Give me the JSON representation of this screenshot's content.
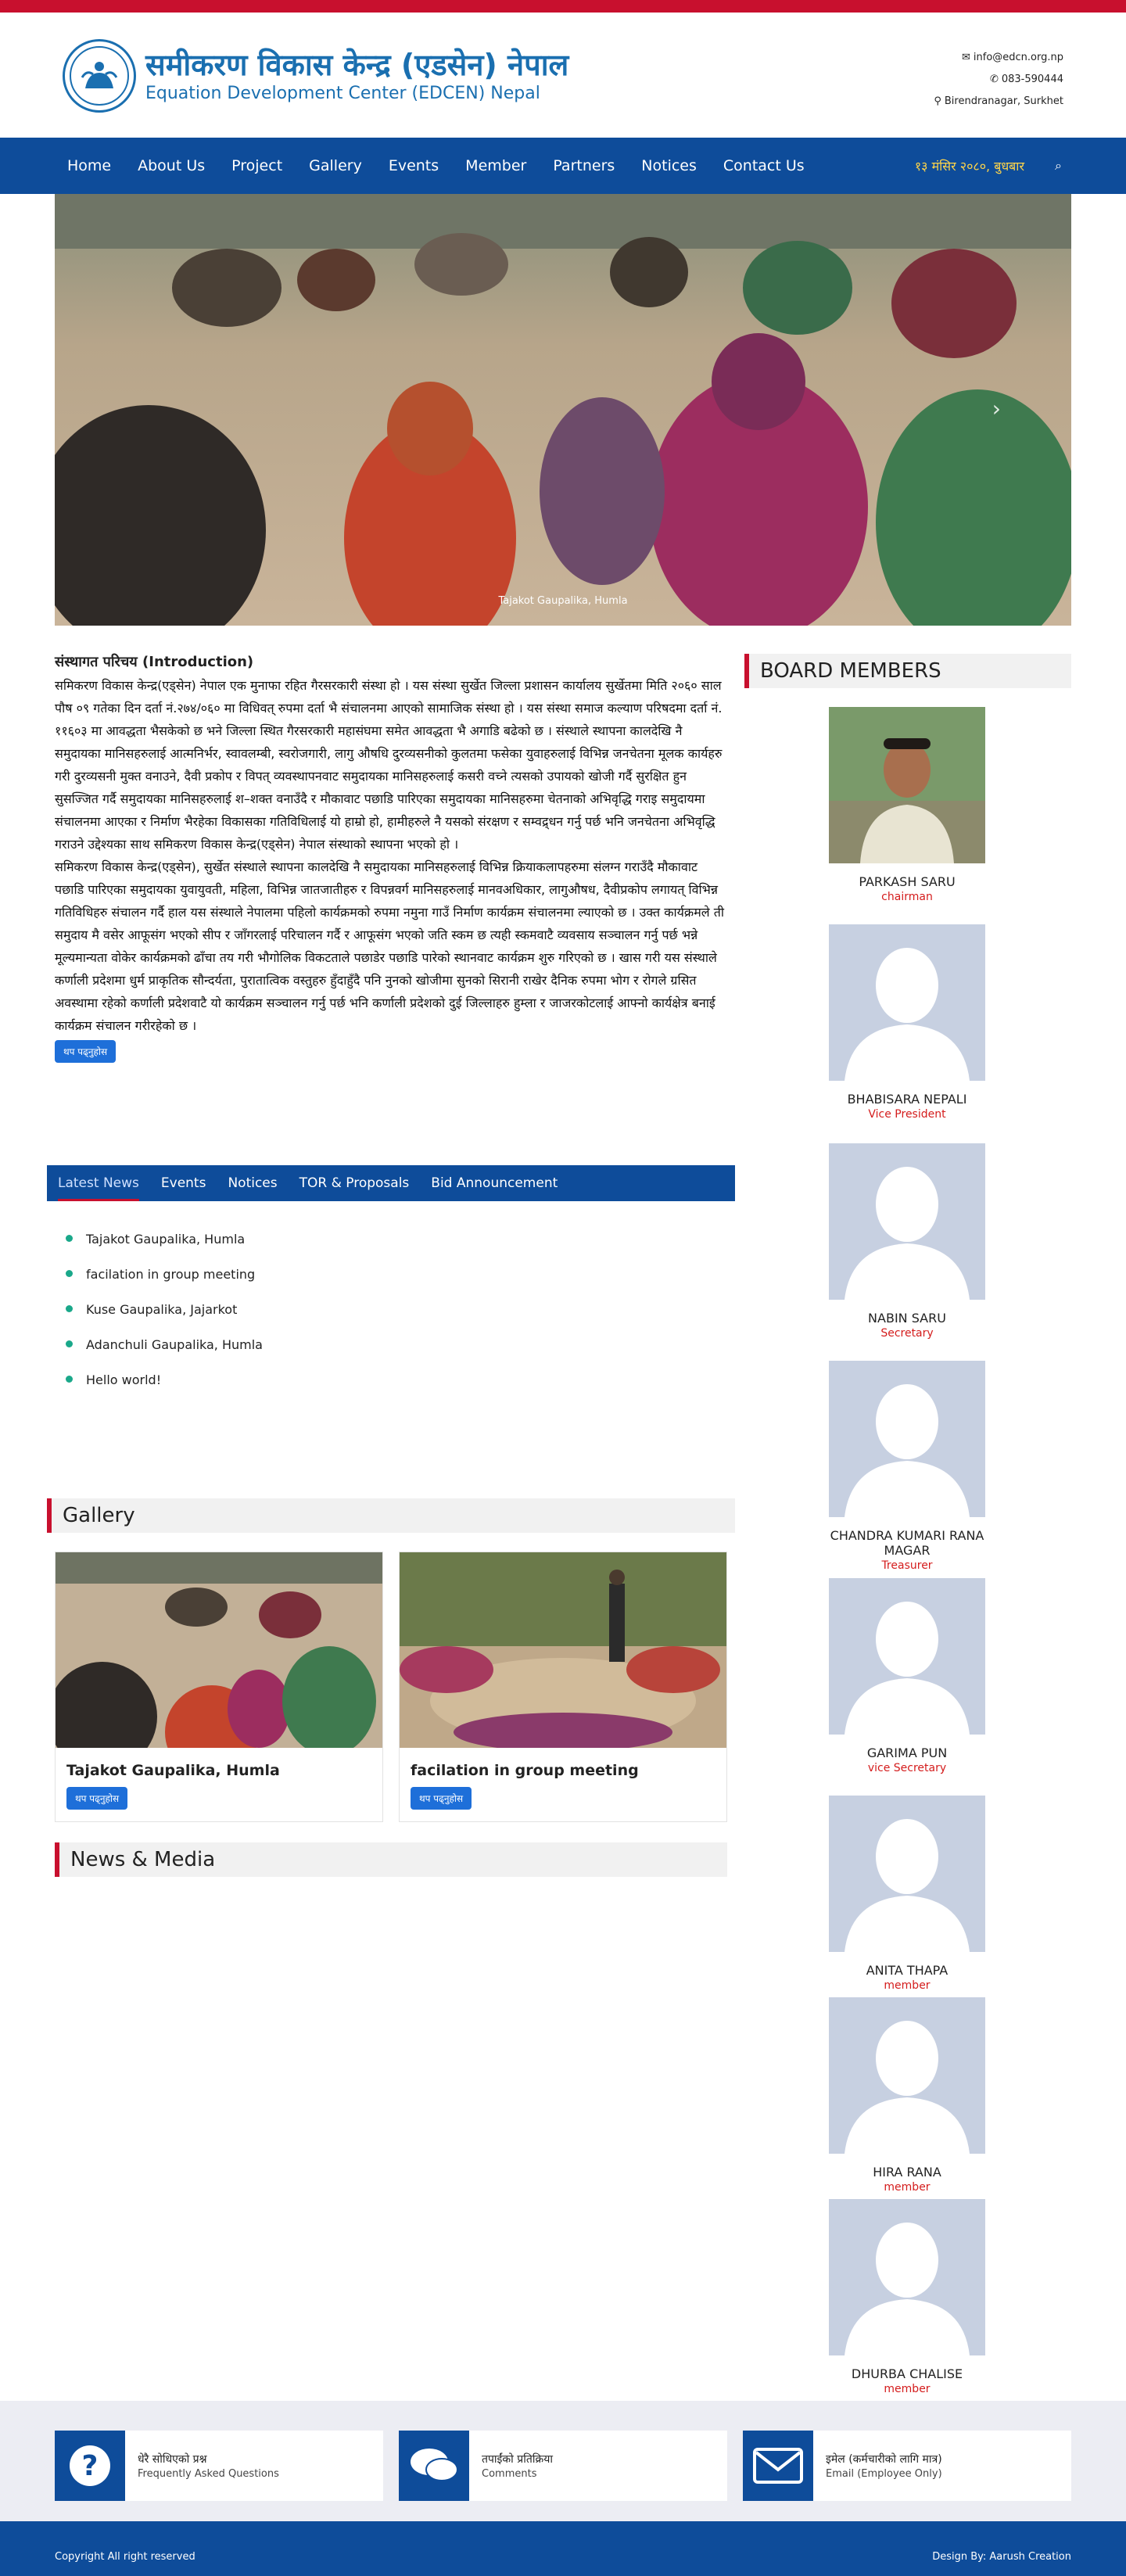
{
  "header": {
    "title_np": "समीकरण विकास केन्द्र (एडसेन) नेपाल",
    "title_en": "Equation Development Center (EDCEN) Nepal",
    "email": "info@edcn.org.np",
    "phone": "083-590444",
    "address": "Birendranagar, Surkhet"
  },
  "nav": {
    "items": [
      "Home",
      "About Us",
      "Project",
      "Gallery",
      "Events",
      "Member",
      "Partners",
      "Notices",
      "Contact Us"
    ],
    "date": "१३ मंसिर २०८०, बुधबार"
  },
  "slider": {
    "caption": "Tajakot Gaupalika, Humla"
  },
  "intro": {
    "heading": "संस्थागत परिचय (Introduction) ",
    "para1": "समिकरण विकास केन्द्र(एड्सेन) नेपाल एक मुनाफा रहित गैरसरकारी संस्था हो । यस संस्था सुर्खेत जिल्ला प्रशासन कार्यालय सुर्खेतमा मिति २०६० साल पौष ०९ गतेका दिन दर्ता नं.२७४/०६० मा विधिवत् रुपमा दर्ता भै संचालनमा आएको सामाजिक संस्था हो । यस संस्था समाज कल्याण परिषदमा दर्ता नं. ११६०३ मा आवद्धता भैसकेको छ भने जिल्ला स्थित गैरसरकारी महासंघमा समेत आवद्धता भै अगाडि बढेको छ । संस्थाले स्थापना कालदेखि नै समुदायका मानिसहरुलाई आत्मनिर्भर, स्वावलम्बी, स्वरोजगारी, लागु औषधि दुरव्यसनीको कुलतमा फसेका युवाहरुलाई विभिन्न जनचेतना मूलक कार्यहरु गरी दुरव्यसनी मुक्त वनाउने, दैवी प्रकोप र विपत् व्यवस्थापनवाट समुदायका मानिसहरुलाई कसरी वच्ने त्यसको उपायको खोजी गर्दै सुरक्षित हुन सुसज्जित गर्दै समुदायका मानिसहरुलाई श–शक्त वनाउँदै र मौकावाट पछाडि पारिएका समुदायका मानिसहरुमा चेतनाको अभिवृद्धि गराइ समुदायमा संचालनमा आएका र निर्माण भैरहेका विकासका गतिविधिलाई यो हाम्रो हो, हामीहरुले नै यसको संरक्षण र सम्वद्र्धन गर्नु पर्छ भनि जनचेतना अभिवृद्धि गराउने उद्देश्यका साथ समिकरण विकास केन्द्र(एड्सेन) नेपाल संस्थाको स्थापना भएको हो ।",
    "para2": "समिकरण विकास केन्द्र(एड्सेन), सुर्खेत संस्थाले स्थापना कालदेखि नै समुदायका मानिसहरुलाई विभिन्न क्रियाकलापहरुमा संलग्न गराउँदै मौकावाट पछाडि पारिएका समुदायका युवायुवती, महिला, विभिन्न जातजातीहरु र विपन्नवर्ग मानिसहरुलाई मानवअधिकार, लागुऔषध, दैवीप्रकोप लगायत् विभिन्न गतिविधिहरु संचालन गर्दै हाल यस संस्थाले नेपालमा पहिलो कार्यक्रमको रुपमा नमुना गाउँ निर्माण कार्यक्रम संचालनमा ल्याएको छ । उक्त कार्यक्रमले ती समुदाय मै वसेर आफूसंग भएको सीप र जाँगरलाई परिचालन गर्दै र आफूसंग भएको जति स्कम छ त्यही स्कमवाटै व्यवसाय सञ्चालन गर्नु पर्छ भन्ने मूल्यमान्यता वोकेर कार्यक्रमको ढाँचा तय गरी भौगोलिक विकटताले पछाडेर पछाडि पारेको स्थानवाट कार्यक्रम शुरु गरिएको छ । खास गरी यस संस्थाले कर्णाली प्रदेशमा धुर्म प्राकृतिक सौन्दर्यता, पुरातात्विक वस्तुहरु हुँदाहुँदै पनि नुनको खोजीमा सुनको सिरानी राखेर दैनिक रुपमा भोग र रोगले ग्रसित अवस्थामा रहेको कर्णाली प्रदेशवाटै यो कार्यक्रम सञ्चालन गर्नु पर्छ भनि कर्णाली प्रदेशको दुई जिल्लाहरु हुम्ला र जाजरकोटलाई आफ्नो कार्यक्षेत्र बनाई कार्यक्रम संचालन गरीरहेको छ ।",
    "more_label": "थप पढ्नुहोस"
  },
  "tabs": {
    "items": [
      "Latest News",
      "Events",
      "Notices",
      "TOR & Proposals",
      "Bid Announcement"
    ],
    "news": [
      "Tajakot Gaupalika, Humla",
      "facilation in group meeting",
      "Kuse Gaupalika, Jajarkot",
      "Adanchuli Gaupalika, Humla",
      "Hello world!"
    ]
  },
  "gallery": {
    "heading": "Gallery",
    "cards": [
      {
        "title": "Tajakot Gaupalika, Humla",
        "btn": "थप पढ्नुहोस"
      },
      {
        "title": "facilation in group meeting",
        "btn": "थप पढ्नुहोस"
      }
    ]
  },
  "news_media": {
    "heading": "News & Media"
  },
  "board": {
    "heading": "BOARD MEMBERS",
    "members": [
      {
        "name": "PARKASH SARU",
        "role": "chairman"
      },
      {
        "name": "BHABISARA NEPALI",
        "role": "Vice President"
      },
      {
        "name": "NABIN SARU",
        "role": "Secretary"
      },
      {
        "name": "CHANDRA KUMARI RANA MAGAR",
        "role": "Treasurer"
      },
      {
        "name": "GARIMA PUN",
        "role": "vice Secretary"
      },
      {
        "name": "ANITA THAPA",
        "role": "member"
      },
      {
        "name": "HIRA RANA",
        "role": "member"
      },
      {
        "name": "DHURBA CHALISE",
        "role": "member"
      }
    ]
  },
  "footer": {
    "boxes": [
      {
        "line1": "धेरै सोधिएको प्रश्न",
        "line2": "Frequently Asked Questions",
        "icon": "question-icon"
      },
      {
        "line1": "तपाईंको प्रतिक्रिया",
        "line2": "Comments",
        "icon": "comments-icon"
      },
      {
        "line1": "इमेल (कर्मचारीको लागि मात्र)",
        "line2": "Email (Employee Only)",
        "icon": "email-icon"
      }
    ],
    "copyright": "Copyright All right reserved",
    "design": "Design By: Aarush Creation"
  },
  "colors": {
    "brand_blue": "#0e4c9a",
    "accent_red": "#c8102e",
    "logo_blue": "#1a6fb0"
  }
}
